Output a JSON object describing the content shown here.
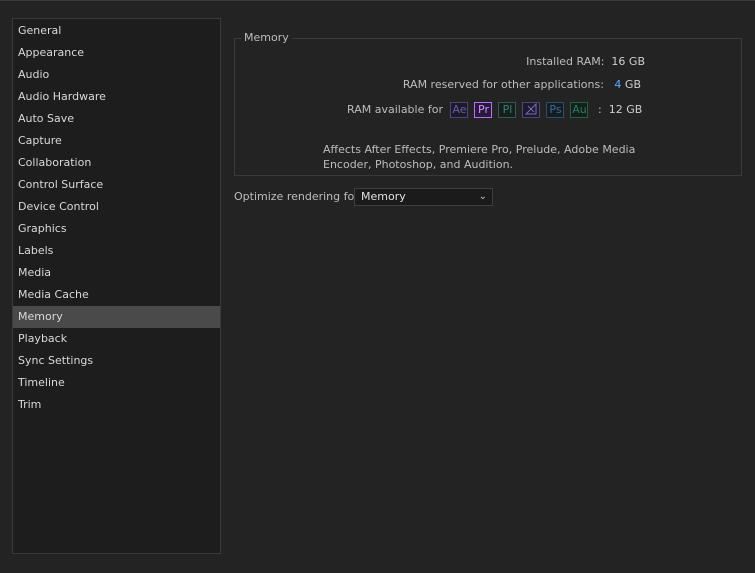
{
  "sidebar": {
    "items": [
      {
        "label": "General"
      },
      {
        "label": "Appearance"
      },
      {
        "label": "Audio"
      },
      {
        "label": "Audio Hardware"
      },
      {
        "label": "Auto Save"
      },
      {
        "label": "Capture"
      },
      {
        "label": "Collaboration"
      },
      {
        "label": "Control Surface"
      },
      {
        "label": "Device Control"
      },
      {
        "label": "Graphics"
      },
      {
        "label": "Labels"
      },
      {
        "label": "Media"
      },
      {
        "label": "Media Cache"
      },
      {
        "label": "Memory"
      },
      {
        "label": "Playback"
      },
      {
        "label": "Sync Settings"
      },
      {
        "label": "Timeline"
      },
      {
        "label": "Trim"
      }
    ],
    "selected": "Memory"
  },
  "memory": {
    "group_title": "Memory",
    "installed_label": "Installed RAM:",
    "installed_value": "16 GB",
    "reserved_label": "RAM reserved for other applications:",
    "reserved_value": "4",
    "reserved_unit": "GB",
    "available_label": "RAM available for",
    "apps": [
      "Ae",
      "Pr",
      "Pl",
      "Me",
      "Ps",
      "Au"
    ],
    "available_sep": ":",
    "available_value": "12 GB",
    "note": "Affects After Effects, Premiere Pro, Prelude, Adobe Media Encoder, Photoshop, and Audition."
  },
  "optimize": {
    "label": "Optimize rendering for:",
    "value": "Memory"
  },
  "colors": {
    "accent": "#5aa9ff",
    "selected_bg": "#4a4a4a"
  }
}
